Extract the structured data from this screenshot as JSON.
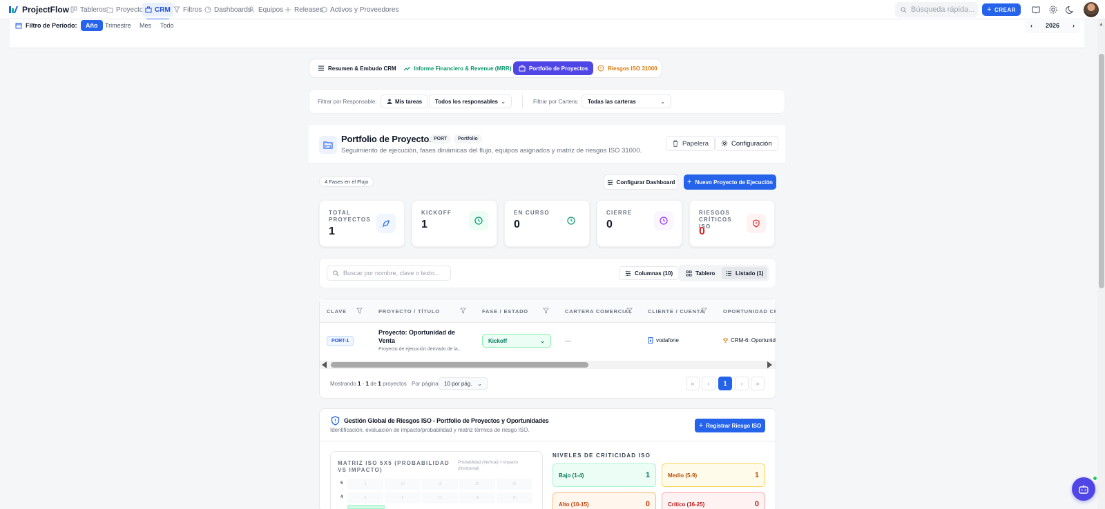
{
  "app": {
    "name": "ProjectFlow"
  },
  "nav": {
    "items": [
      {
        "label": "Tableros",
        "icon": "board-icon"
      },
      {
        "label": "Proyectos",
        "icon": "folder-icon"
      },
      {
        "label": "CRM",
        "icon": "briefcase-icon",
        "active": true
      },
      {
        "label": "Filtros",
        "icon": "filter-icon"
      },
      {
        "label": "Dashboards",
        "icon": "dashboard-icon"
      },
      {
        "label": "Equipos",
        "icon": "users-icon"
      },
      {
        "label": "Releases",
        "icon": "release-icon"
      },
      {
        "label": "Activos y Proveedores",
        "icon": "package-icon"
      }
    ],
    "search_placeholder": "Búsqueda rápida...",
    "create_label": "CREAR"
  },
  "period": {
    "label": "Filtro de Período:",
    "tabs": [
      {
        "label": "Año",
        "active": true
      },
      {
        "label": "Trimestre"
      },
      {
        "label": "Mes"
      },
      {
        "label": "Todo"
      }
    ],
    "year": "2026"
  },
  "module_tabs": [
    {
      "label": "Resumen & Embudo CRM",
      "color": "#111827",
      "icon": "list-icon"
    },
    {
      "label": "Informe Financiero & Revenue (MRR)",
      "color": "#059669",
      "icon": "trend-icon"
    },
    {
      "label": "Portfolio de Proyectos",
      "color": "#ffffff",
      "active": true,
      "icon": "briefcase-icon"
    },
    {
      "label": "Riesgos ISO 31000",
      "color": "#d97706",
      "icon": "alert-icon"
    }
  ],
  "filters": {
    "owner_label": "Filtrar por Responsable:",
    "my_tasks": "Mis tareas",
    "owner_select": "Todos los responsables",
    "portfolio_label": "Filtrar por Cartera:",
    "portfolio_select": "Todas las carteras"
  },
  "header": {
    "title": "Portfolio de Proyectos",
    "chips": [
      "PORT",
      "Portfolio"
    ],
    "subtitle": "Seguimiento de ejecución, fases dinámicas del flujo, equipos asignados y matriz de riesgos ISO 31000.",
    "trash_label": "Papelera",
    "config_label": "Configuración"
  },
  "actions": {
    "phases_chip": "4 Fases en el Flujo",
    "config_dashboard": "Configurar Dashboard",
    "new_project": "Nuevo Proyecto de Ejecución"
  },
  "kpis": [
    {
      "label": "TOTAL PROYECTOS",
      "value": "1",
      "icon": "rocket-icon",
      "color": "#2563eb",
      "bg": "#eff6ff"
    },
    {
      "label": "KICKOFF",
      "value": "1",
      "icon": "clock-icon",
      "color": "#059669",
      "bg": "#ecfdf5"
    },
    {
      "label": "EN CURSO",
      "value": "0",
      "icon": "clock-icon",
      "color": "#059669",
      "bg": "#ffffff"
    },
    {
      "label": "CIERRE",
      "value": "0",
      "icon": "clock-icon",
      "color": "#9333ea",
      "bg": "#faf5ff"
    },
    {
      "label": "RIESGOS CRÍTICOS ISO",
      "value": "0",
      "icon": "shield-alert-icon",
      "color": "#dc2626",
      "bg": "#fef2f2"
    }
  ],
  "toolbar": {
    "search_placeholder": "Buscar por nombre, clave o texto...",
    "columns": "Columnas (10)",
    "board_view": "Tablero",
    "list_view": "Listado (1)"
  },
  "table": {
    "columns": [
      "CLAVE",
      "PROYECTO / TÍTULO",
      "FASE / ESTADO",
      "CARTERA COMERCIAL",
      "CLIENTE / CUENTA",
      "OPORTUNIDAD CRM"
    ],
    "rows": [
      {
        "clave": "PORT-1",
        "title": "Proyecto: Oportunidad de Venta",
        "desc": "Proyecto de ejecución derivado de la...",
        "fase": "Kickoff",
        "cartera": "—",
        "cliente": "vodafone",
        "oportunidad": "CRM-6: Oportunid"
      }
    ],
    "footer": {
      "showing_prefix": "Mostrando",
      "from": "1",
      "to": "1",
      "of": "de",
      "total": "1",
      "suffix": "proyectos",
      "per_page_label": "Por página:",
      "per_page": "10 por pág.",
      "current_page": "1"
    }
  },
  "risk": {
    "title": "Gestión Global de Riesgos ISO - Portfolio de Proyectos y Oportunidades",
    "subtitle": "Identificación, evaluación de impacto/probabilidad y matriz térmica de riesgo ISO.",
    "register": "Registrar Riesgo ISO",
    "matrix_title": "MATRIZ ISO 5X5 (PROBABILIDAD VS IMPACTO)",
    "matrix_note": "Probabilidad (Vertical) × Impacto (Horizontal)",
    "matrix_rows": [
      {
        "label": "5",
        "cells": [
          "5",
          "10",
          "15",
          "20",
          "25"
        ]
      },
      {
        "label": "4",
        "cells": [
          "4",
          "8",
          "12",
          "16",
          "20"
        ]
      }
    ],
    "levels_title": "NIVELES DE CRITICIDAD ISO",
    "levels": [
      {
        "label": "Bajo (1-4)",
        "count": "1",
        "color": "#047857",
        "bg": "#ecfdf5",
        "border": "#a7f3d0"
      },
      {
        "label": "Medio (5-9)",
        "count": "1",
        "color": "#b45309",
        "bg": "#fffbeb",
        "border": "#fcd34d"
      },
      {
        "label": "Alto (10-15)",
        "count": "0",
        "color": "#c2410c",
        "bg": "#fff7ed",
        "border": "#fdba74"
      },
      {
        "label": "Crítico (16-25)",
        "count": "0",
        "color": "#b91c1c",
        "bg": "#fef2f2",
        "border": "#fca5a5"
      }
    ]
  }
}
